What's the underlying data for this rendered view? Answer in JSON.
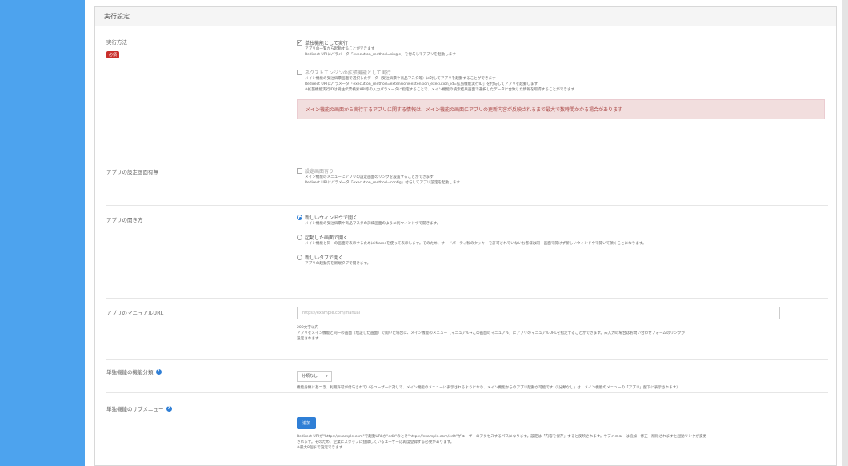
{
  "panel": {
    "title": "実行設定"
  },
  "exec": {
    "label": "実行方法",
    "required": "必須",
    "opt1": {
      "label": "単独機能として実行",
      "checked": true,
      "desc": [
        "アプリの一覧から起動することができます",
        "Redirect URIにパラメータ「execution_method=single」を付与してアプリを起動します"
      ]
    },
    "opt2": {
      "label": "ネクストエンジンの拡張機能として実行",
      "checked": false,
      "desc": [
        "メイン機能の受注伝票画面で選択したデータ（受注伝票や商品マスタ等）に対してアプリを起動することができます",
        "Redirect URIにパラメータ「execution_method=extension&extension_execution_id=拡張機能実行ID」を付与してアプリを起動します",
        "※拡張機能実行IDは受注伝票検索API等の入力パラメータに指定することで、メイン機能の検索結果画面で選択したデータに合致した情報を取得することができます"
      ]
    },
    "alert": "メイン機能の画面から実行するアプリに関する情報は、メイン機能の画面にアプリの更新内容が反映されるまで最大で数時間かかる場合があります"
  },
  "config": {
    "label": "アプリの設定画面有無",
    "opt": {
      "label": "設定画面有り",
      "checked": false
    },
    "desc": [
      "メイン機能のメニューにアプリの設定画面のリンクを設置することができます",
      "Redirect URIにパラメータ「execution_method=config」付与してアプリ設定を起動します"
    ]
  },
  "open": {
    "label": "アプリの開き方",
    "options": [
      {
        "label": "新しいウィンドウで開く",
        "selected": true,
        "desc": "メイン機能の受注伝票や商品マスタの詳細画面のように別ウィンドウで開きます。"
      },
      {
        "label": "起動した画面で開く",
        "selected": false,
        "desc": "メイン機能と同一の画面で表示するためにiframeを使って表示します。そのため、サードパーティ製のクッキーを許可されていないお客様は同一画面で開けず新しいウィンドウで開いて頂くことになります。"
      },
      {
        "label": "新しいタブで開く",
        "selected": false,
        "desc": "アプリの起動先を新規タブで開きます。"
      }
    ]
  },
  "manual": {
    "label": "アプリのマニュアルURL",
    "placeholder": "https://example.com/manual",
    "desc": [
      "200文字以内",
      "アプリをメイン機能と同一の画面（埋設した画面）で開いた場合に、メイン機能のメニュー（マニュアル→この画面のマニュアル）にアプリのマニュアルURLを指定することができます。未入力の場合はお問い合わせフォームのリンクが",
      "設定されます"
    ]
  },
  "category": {
    "label": "単独機能の機能分類",
    "select_value": "分類なし",
    "desc": "機能分類に基づき、利用許可が付与されているユーザーに対して、メイン機能のメニューに表示されるようになり、メイン機能からのアプリ起動が可能です（「分類なし」は、メイン機能のメニューの「アプリ」配下に表示されます）"
  },
  "submenu": {
    "label": "単独機能のサブメニュー",
    "add_button": "追加",
    "desc": [
      "Redirect URIが\"https://example.com\"で起動URLが\"edit\"のとき\"https://example.com/edit\"がユーザーのアクセスするパスになります。設定は「内容を保存」すると反映されます。サブメニューは追加・修正・削除されますと起動リンクが変更",
      "されます。そのため、企業にスタッフに登録しているユーザーは再度登録する必要があります。",
      "※最大8個まで設定できます"
    ]
  },
  "icons": {
    "help": "help-circle-icon",
    "checkbox": "checkbox-icon",
    "radio": "radio-icon",
    "caret": "caret-down-icon"
  },
  "colors": {
    "sidebar": "#4da3ee",
    "accent": "#2f7fd6",
    "required": "#c9302c",
    "alert_bg": "#f2dede",
    "alert_text": "#a94442"
  }
}
